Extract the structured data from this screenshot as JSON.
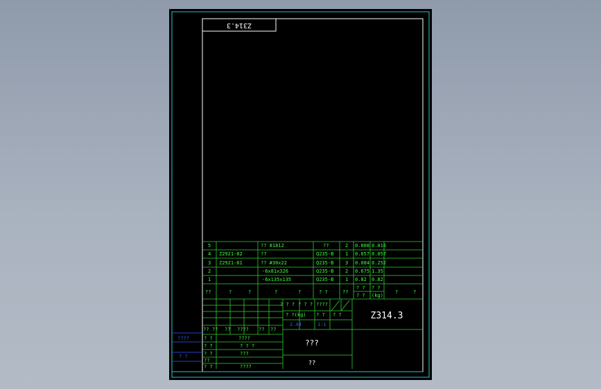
{
  "drawing": {
    "code_mirrored": "Z314.3",
    "code": "Z314.3",
    "title": "???",
    "company": "??"
  },
  "bom": {
    "rows": [
      {
        "no": "5",
        "code": "",
        "name": "?? 81812",
        "material": "??",
        "qty": "2",
        "unit_w": "0.008",
        "total_w": "0.016"
      },
      {
        "no": "4",
        "code": "Z2921-82",
        "name": "??",
        "material": "Q235-B",
        "qty": "1",
        "unit_w": "0.057",
        "total_w": "0.057"
      },
      {
        "no": "3",
        "code": "Z2921-81",
        "name": "?? #30x22",
        "material": "Q235-B",
        "qty": "3",
        "unit_w": "0.084",
        "total_w": "0.252"
      },
      {
        "no": "2",
        "code": "",
        "name": "-6x81x326",
        "material": "Q235-B",
        "qty": "2",
        "unit_w": "0.675",
        "total_w": "1.35"
      },
      {
        "no": "1",
        "code": "",
        "name": "-6x135x135",
        "material": "Q235-B",
        "qty": "1",
        "unit_w": "0.82",
        "total_w": "0.82"
      }
    ],
    "header": {
      "c1": "??",
      "c2": "?",
      "c3": "?",
      "c4": "?",
      "c5": "?",
      "c6": "? ?",
      "c7": "??",
      "w_top1": "? ?",
      "w_top2": "? ?",
      "w_bot1": "? ?",
      "w_bot2": "(kg)",
      "c9": "?",
      "c10": "?"
    }
  },
  "title_block": {
    "stage_row": [
      "? ? ?",
      "? ? ?",
      "????"
    ],
    "mass_label": "? ?(kg)",
    "scale_label": "? ?",
    "sheet_label": "? ?",
    "mass_value": "2.44",
    "scale_value": "1:1",
    "sig_header": [
      "??",
      "??",
      "??",
      "????",
      "??",
      "??"
    ],
    "roles": [
      "? ?",
      "? ?",
      "? ?",
      "??",
      "? ?"
    ],
    "role_marks": [
      "????",
      "? ? ?",
      "???",
      "",
      "????"
    ],
    "side_labels": [
      "????",
      "?  ?"
    ]
  }
}
